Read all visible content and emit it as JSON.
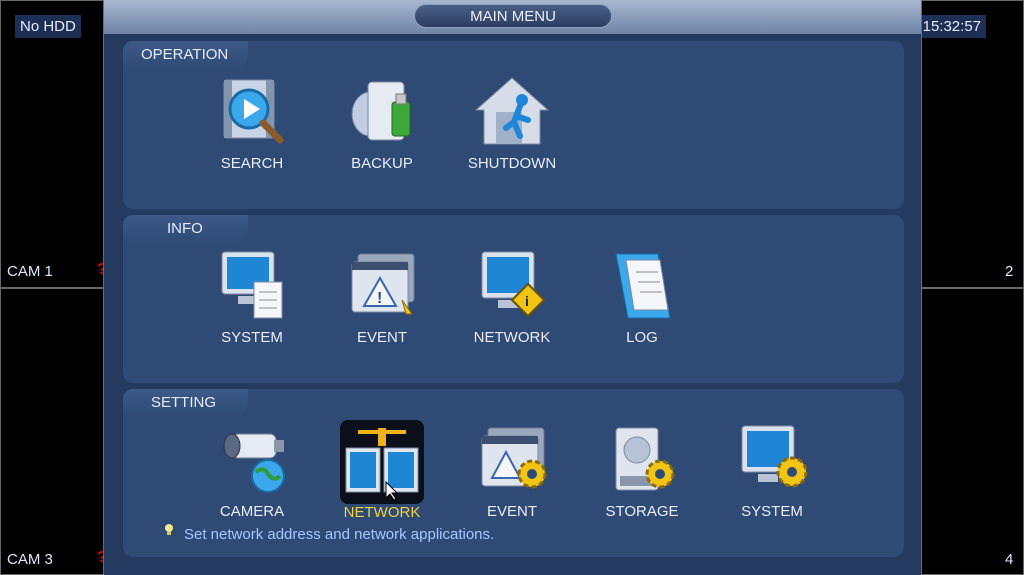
{
  "status": {
    "hdd": "No HDD",
    "clock": "15:32:57"
  },
  "cams": [
    {
      "label": "CAM 1"
    },
    {
      "label": "2"
    },
    {
      "label": "CAM 3"
    },
    {
      "label": "4"
    }
  ],
  "menu": {
    "title": "MAIN MENU",
    "operation": {
      "title": "OPERATION",
      "items": [
        {
          "label": "SEARCH",
          "icon": "search-icon"
        },
        {
          "label": "BACKUP",
          "icon": "backup-icon"
        },
        {
          "label": "SHUTDOWN",
          "icon": "shutdown-icon"
        }
      ]
    },
    "info": {
      "title": "INFO",
      "items": [
        {
          "label": "SYSTEM",
          "icon": "system-info-icon"
        },
        {
          "label": "EVENT",
          "icon": "event-info-icon"
        },
        {
          "label": "NETWORK",
          "icon": "network-info-icon"
        },
        {
          "label": "LOG",
          "icon": "log-icon"
        }
      ]
    },
    "setting": {
      "title": "SETTING",
      "items": [
        {
          "label": "CAMERA",
          "icon": "camera-icon"
        },
        {
          "label": "NETWORK",
          "icon": "network-setting-icon",
          "selected": true
        },
        {
          "label": "EVENT",
          "icon": "event-setting-icon"
        },
        {
          "label": "STORAGE",
          "icon": "storage-icon"
        },
        {
          "label": "SYSTEM",
          "icon": "system-setting-icon"
        }
      ]
    },
    "hint": "Set network address and network applications."
  },
  "colors": {
    "accent": "#f0d23c",
    "panel": "#2e4a75",
    "menu_bg": "#243a5f",
    "hint": "#a8c6ff"
  }
}
